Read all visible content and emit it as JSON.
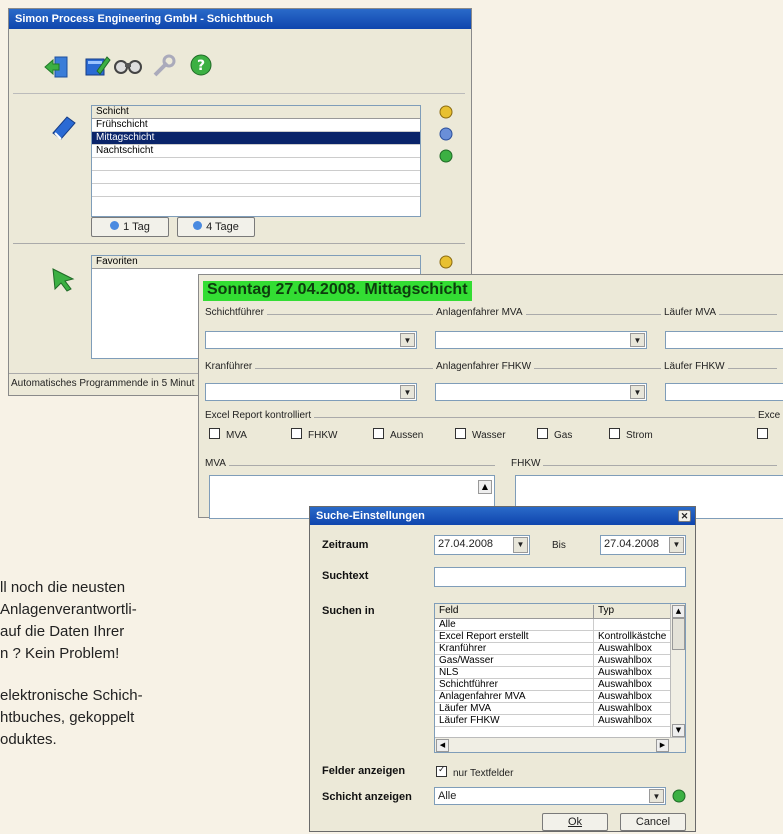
{
  "main": {
    "title": "Simon Process Engineering GmbH - Schichtbuch",
    "shift_list": {
      "header": "Schicht",
      "items": [
        "Frühschicht",
        "Mittagschicht",
        "Nachtschicht"
      ],
      "selected": 1
    },
    "btn_1tag": "1 Tag",
    "btn_4tage": "4 Tage",
    "favorites_header": "Favoriten",
    "status": "Automatisches Programmende in 5 Minut"
  },
  "shift": {
    "heading": "Sonntag 27.04.2008. Mittagschicht",
    "fields": {
      "schichtfuehrer": "Schichtführer",
      "anlagenfahrer_mva": "Anlagenfahrer MVA",
      "laeufer_mva": "Läufer MVA",
      "kranfuehrer": "Kranführer",
      "anlagenfahrer_fhkw": "Anlagenfahrer FHKW",
      "laeufer_fhkw": "Läufer FHKW"
    },
    "excel_group": "Excel Report kontrolliert",
    "excel_group2": "Exce",
    "checks": [
      "MVA",
      "FHKW",
      "Aussen",
      "Wasser",
      "Gas",
      "Strom"
    ],
    "mva_label": "MVA",
    "fhkw_label": "FHKW"
  },
  "search": {
    "title": "Suche-Einstellungen",
    "zeitraum_label": "Zeitraum",
    "from_date": "27.04.2008",
    "bis_label": "Bis",
    "to_date": "27.04.2008",
    "suchtext_label": "Suchtext",
    "suchen_in_label": "Suchen in",
    "col_feld": "Feld",
    "col_typ": "Typ",
    "rows": [
      {
        "feld": "Alle",
        "typ": ""
      },
      {
        "feld": "Excel Report erstellt",
        "typ": "Kontrollkästche"
      },
      {
        "feld": "Kranführer",
        "typ": "Auswahlbox"
      },
      {
        "feld": "Gas/Wasser",
        "typ": "Auswahlbox"
      },
      {
        "feld": "NLS",
        "typ": "Auswahlbox"
      },
      {
        "feld": "Schichtführer",
        "typ": "Auswahlbox"
      },
      {
        "feld": "Anlagenfahrer MVA",
        "typ": "Auswahlbox"
      },
      {
        "feld": "Läufer MVA",
        "typ": "Auswahlbox"
      },
      {
        "feld": "Läufer FHKW",
        "typ": "Auswahlbox"
      }
    ],
    "felder_label": "Felder anzeigen",
    "nur_text": "nur Textfelder",
    "schicht_label": "Schicht anzeigen",
    "schicht_value": "Alle",
    "ok": "Ok",
    "cancel": "Cancel"
  },
  "text": {
    "lines": [
      "ll noch die neusten",
      "Anlagenverantwortli-",
      "auf die Daten Ihrer",
      "n ? Kein Problem!",
      "elektronische Schich-",
      "htbuches, gekoppelt",
      "oduktes."
    ]
  },
  "colors": {
    "title_blue": "#0f45ad",
    "heading_green": "#33dd33",
    "selection": "#0a246a"
  }
}
